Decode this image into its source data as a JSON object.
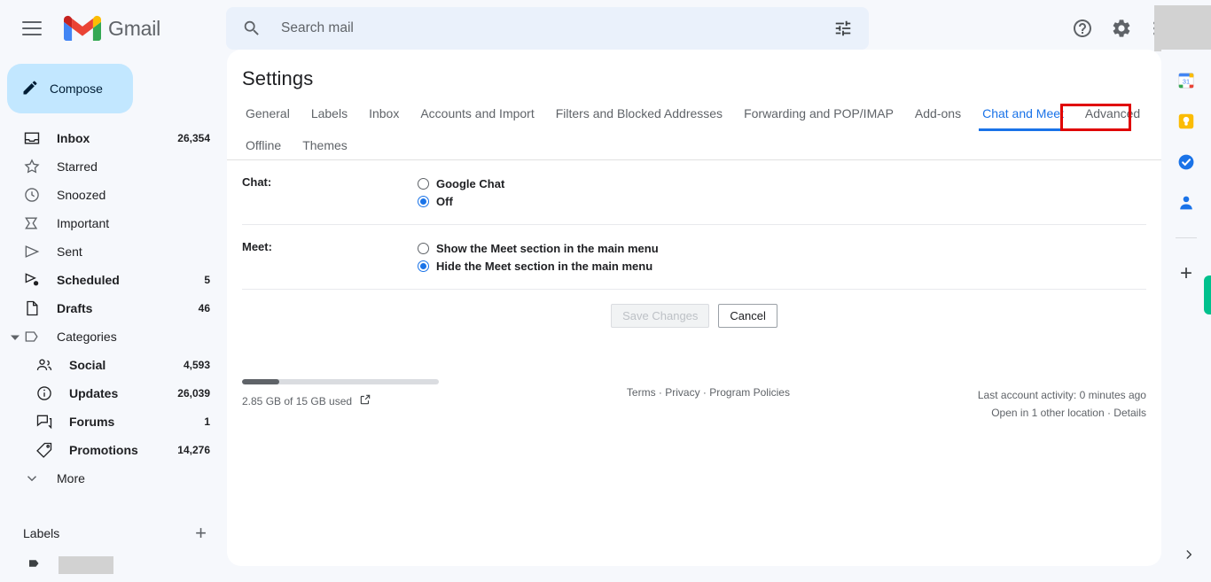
{
  "topbar": {
    "menu_icon": "hamburger-menu-icon",
    "brand": "Gmail",
    "search_placeholder": "Search mail",
    "search_value": "",
    "search_icon": "search-icon",
    "filter_icon": "tune-filter-icon",
    "help_icon": "help-icon",
    "settings_icon": "gear-icon",
    "apps_icon": "apps-grid-icon"
  },
  "sidebar": {
    "compose_label": "Compose",
    "compose_icon": "pencil-icon",
    "items": [
      {
        "label": "Inbox",
        "count": "26,354",
        "icon": "inbox-icon",
        "bold": true
      },
      {
        "label": "Starred",
        "count": "",
        "icon": "star-icon",
        "bold": false
      },
      {
        "label": "Snoozed",
        "count": "",
        "icon": "clock-icon",
        "bold": false
      },
      {
        "label": "Important",
        "count": "",
        "icon": "important-label-icon",
        "bold": false
      },
      {
        "label": "Sent",
        "count": "",
        "icon": "send-icon",
        "bold": false
      },
      {
        "label": "Scheduled",
        "count": "5",
        "icon": "scheduled-send-icon",
        "bold": true
      },
      {
        "label": "Drafts",
        "count": "46",
        "icon": "draft-file-icon",
        "bold": true
      },
      {
        "label": "Categories",
        "count": "",
        "icon": "label-tag-icon",
        "bold": false
      }
    ],
    "categories": [
      {
        "label": "Social",
        "count": "4,593",
        "icon": "people-icon",
        "bold": true
      },
      {
        "label": "Updates",
        "count": "26,039",
        "icon": "info-icon",
        "bold": true
      },
      {
        "label": "Forums",
        "count": "1",
        "icon": "forum-icon",
        "bold": true
      },
      {
        "label": "Promotions",
        "count": "14,276",
        "icon": "offer-tag-icon",
        "bold": true
      }
    ],
    "more_label": "More",
    "more_icon": "chevron-down-icon",
    "labels_title": "Labels",
    "add_label_icon": "plus-icon",
    "label_item_icon": "label-tag-icon"
  },
  "main": {
    "title": "Settings",
    "tabs_row1": [
      {
        "label": "General",
        "active": false
      },
      {
        "label": "Labels",
        "active": false
      },
      {
        "label": "Inbox",
        "active": false
      },
      {
        "label": "Accounts and Import",
        "active": false
      },
      {
        "label": "Filters and Blocked Addresses",
        "active": false
      },
      {
        "label": "Forwarding and POP/IMAP",
        "active": false
      },
      {
        "label": "Add-ons",
        "active": false
      },
      {
        "label": "Chat and Meet",
        "active": true
      },
      {
        "label": "Advanced",
        "active": false
      }
    ],
    "tabs_row2": [
      {
        "label": "Offline",
        "active": false
      },
      {
        "label": "Themes",
        "active": false
      }
    ],
    "highlighted_tab": "Advanced",
    "highlight_color": "#e00000",
    "accent_color": "#1a73e8",
    "sections": [
      {
        "label": "Chat:",
        "options": [
          {
            "label": "Google Chat",
            "selected": false
          },
          {
            "label": "Off",
            "selected": true
          }
        ]
      },
      {
        "label": "Meet:",
        "options": [
          {
            "label": "Show the Meet section in the main menu",
            "selected": false
          },
          {
            "label": "Hide the Meet section in the main menu",
            "selected": true
          }
        ]
      }
    ],
    "save_label": "Save Changes",
    "save_disabled": true,
    "cancel_label": "Cancel"
  },
  "footer": {
    "storage_text": "2.85 GB of 15 GB used",
    "storage_percent": 19,
    "open_external_icon": "open-in-new-icon",
    "links": "Terms · Privacy · Program Policies",
    "activity": "Last account activity: 0 minutes ago",
    "location": "Open in 1 other location · Details"
  },
  "rail": {
    "icons": [
      "calendar-icon",
      "keep-icon",
      "tasks-icon",
      "contacts-icon"
    ],
    "add_icon": "plus-icon",
    "expand_icon": "chevron-right-icon",
    "green_tab_color": "#00c18d"
  }
}
